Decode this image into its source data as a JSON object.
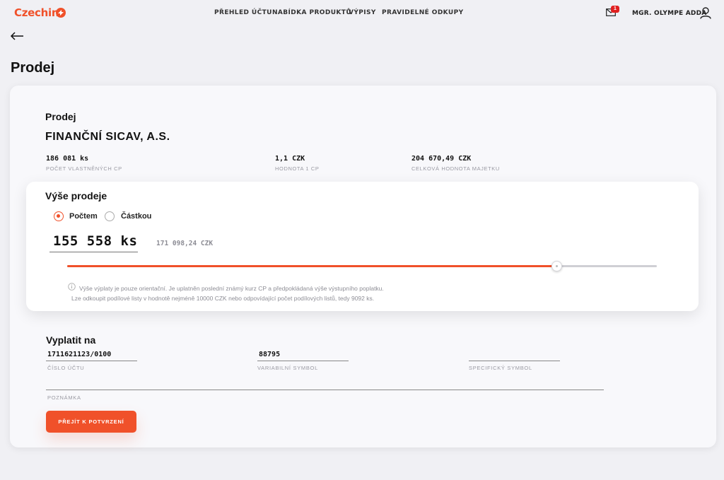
{
  "brand": {
    "name": "Czechin",
    "accent": "#f0512a"
  },
  "nav": {
    "items": [
      {
        "label": "PŘEHLED ÚČTU"
      },
      {
        "label": "NABÍDKA PRODUKTŮ"
      },
      {
        "label": "VÝPISY"
      },
      {
        "label": "PRAVIDELNÉ ODKUPY"
      }
    ],
    "mail_badge": "1",
    "user_name": "MGR. OLYMPE ADDA"
  },
  "page": {
    "title": "Prodej"
  },
  "sale": {
    "section_title": "Prodej",
    "fund_name": "FINANČNÍ SICAV, A.S.",
    "stats": [
      {
        "value": "186 081 ks",
        "label": "POČET VLASTNĚNÝCH CP"
      },
      {
        "value": "1,1 CZK",
        "label": "HODNOTA 1 CP"
      },
      {
        "value": "204 670,49 CZK",
        "label": "CELKOVÁ HODNOTA MAJETKU"
      }
    ]
  },
  "amount_box": {
    "title": "Výše prodeje",
    "options": [
      {
        "label": "Počtem",
        "selected": true
      },
      {
        "label": "Částkou",
        "selected": false
      }
    ],
    "amount": "155 558 ks",
    "amount_czk": "171 098,24 CZK",
    "slider_level": 0.83,
    "note_line1": "Výše výplaty je pouze orientační. Je uplatněn poslední známý kurz CP a předpokládaná výše výstupního poplatku.",
    "note_line2": "Lze odkoupit podílové listy v hodnotě nejméně 10000 CZK nebo odpovídající počet podílových listů, tedy 9092 ks."
  },
  "payout": {
    "title": "Vyplatit na",
    "account": {
      "value": "1711621123/0100",
      "label": "ČÍSLO ÚČTU"
    },
    "variable_symbol": {
      "value": "88795",
      "label": "VARIABILNÍ SYMBOL"
    },
    "specific_symbol": {
      "value": "",
      "label": "SPECIFICKÝ SYMBOL"
    },
    "note": {
      "value": "",
      "label": "POZNÁMKA"
    },
    "confirm_label": "PŘEJÍT K POTVRZENÍ"
  }
}
